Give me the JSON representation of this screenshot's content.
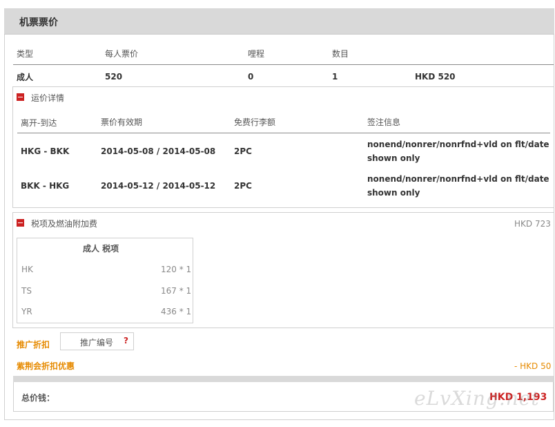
{
  "header": {
    "title": "机票票价"
  },
  "summary": {
    "col_type": "类型",
    "col_price": "每人票价",
    "col_mileage": "哩程",
    "col_count": "数目",
    "row": {
      "type": "成人",
      "price": "520",
      "mileage": "0",
      "count": "1",
      "total": "HKD 520"
    }
  },
  "fare_details": {
    "title": "运价详情",
    "col_route": "离开-到达",
    "col_validity": "票价有效期",
    "col_baggage": "免费行李额",
    "col_endorsement": "签注信息",
    "rows": [
      {
        "route": "HKG - BKK",
        "validity": "2014-05-08 / 2014-05-08",
        "baggage": "2PC",
        "endorsement_line1": "nonend/nonrer/nonrfnd+vld on flt/date",
        "endorsement_line2": "shown only"
      },
      {
        "route": "BKK - HKG",
        "validity": "2014-05-12 / 2014-05-12",
        "baggage": "2PC",
        "endorsement_line1": "nonend/nonrer/nonrfnd+vld on flt/date",
        "endorsement_line2": "shown only"
      }
    ]
  },
  "taxes": {
    "title": "税项及燃油附加费",
    "total": "HKD 723",
    "table_title": "成人  税项",
    "rows": [
      {
        "code": "HK",
        "amount": "120 * 1"
      },
      {
        "code": "TS",
        "amount": "167 * 1"
      },
      {
        "code": "YR",
        "amount": "436 * 1"
      }
    ]
  },
  "promo": {
    "label": "推广折扣",
    "input_placeholder": "推广编号",
    "help": "?"
  },
  "member_discount": {
    "label": "紫荆会折扣优惠",
    "amount": "- HKD 50"
  },
  "total": {
    "label": "总价钱：",
    "amount": "HKD 1,193"
  },
  "watermark": "eLvXing.net",
  "colors": {
    "accent_red": "#cc2222",
    "accent_orange": "#e68a00",
    "header_gray": "#d9d9d9"
  },
  "icons": {
    "collapse": "minus-square-icon"
  }
}
